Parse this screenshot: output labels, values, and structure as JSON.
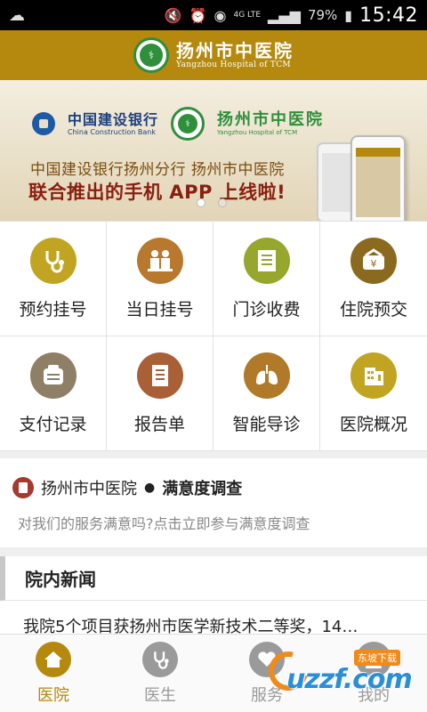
{
  "status": {
    "network": "4G LTE",
    "battery": "79%",
    "time": "15:42"
  },
  "header": {
    "title_cn": "扬州市中医院",
    "title_en": "Yangzhou Hospital of TCM"
  },
  "banner": {
    "bank_cn": "中国建设银行",
    "bank_en": "China Construction Bank",
    "hosp_cn": "扬州市中医院",
    "hosp_en": "Yangzhou Hospital of TCM",
    "line1": "中国建设银行扬州分行   扬州市中医院",
    "line2": "联合推出的手机 APP 上线啦!",
    "active_slide": 1,
    "slide_count": 2
  },
  "grid": [
    {
      "label": "预约挂号",
      "icon": "stethoscope-icon",
      "color": "#c1a522"
    },
    {
      "label": "当日挂号",
      "icon": "doctor-patient-icon",
      "color": "#b8782e"
    },
    {
      "label": "门诊收费",
      "icon": "receipt-icon",
      "color": "#97a62d"
    },
    {
      "label": "住院预交",
      "icon": "wallet-icon",
      "color": "#8b6a1f"
    },
    {
      "label": "支付记录",
      "icon": "record-icon",
      "color": "#8e7f66"
    },
    {
      "label": "报告单",
      "icon": "report-icon",
      "color": "#a96036"
    },
    {
      "label": "智能导诊",
      "icon": "lungs-icon",
      "color": "#b07a28"
    },
    {
      "label": "医院概况",
      "icon": "hospital-building-icon",
      "color": "#c1a522"
    }
  ],
  "survey": {
    "hospital": "扬州市中医院",
    "separator": "●",
    "title": "满意度调查",
    "description": "对我们的服务满意吗?点击立即参与满意度调查"
  },
  "news": {
    "heading": "院内新闻",
    "items": [
      "我院5个项目获扬州市医学新技术二等奖，14…"
    ]
  },
  "tabbar": {
    "tabs": [
      {
        "label": "医院",
        "icon": "home-icon",
        "active": true
      },
      {
        "label": "医生",
        "icon": "stethoscope-icon",
        "active": false
      },
      {
        "label": "服务",
        "icon": "heart-icon",
        "active": false
      },
      {
        "label": "我的",
        "icon": "person-icon",
        "active": false
      }
    ],
    "active_color": "#b4890d",
    "inactive_color": "#9a9a9a"
  },
  "watermark": {
    "main": "uzzf.com",
    "sub": "东坡下载"
  }
}
